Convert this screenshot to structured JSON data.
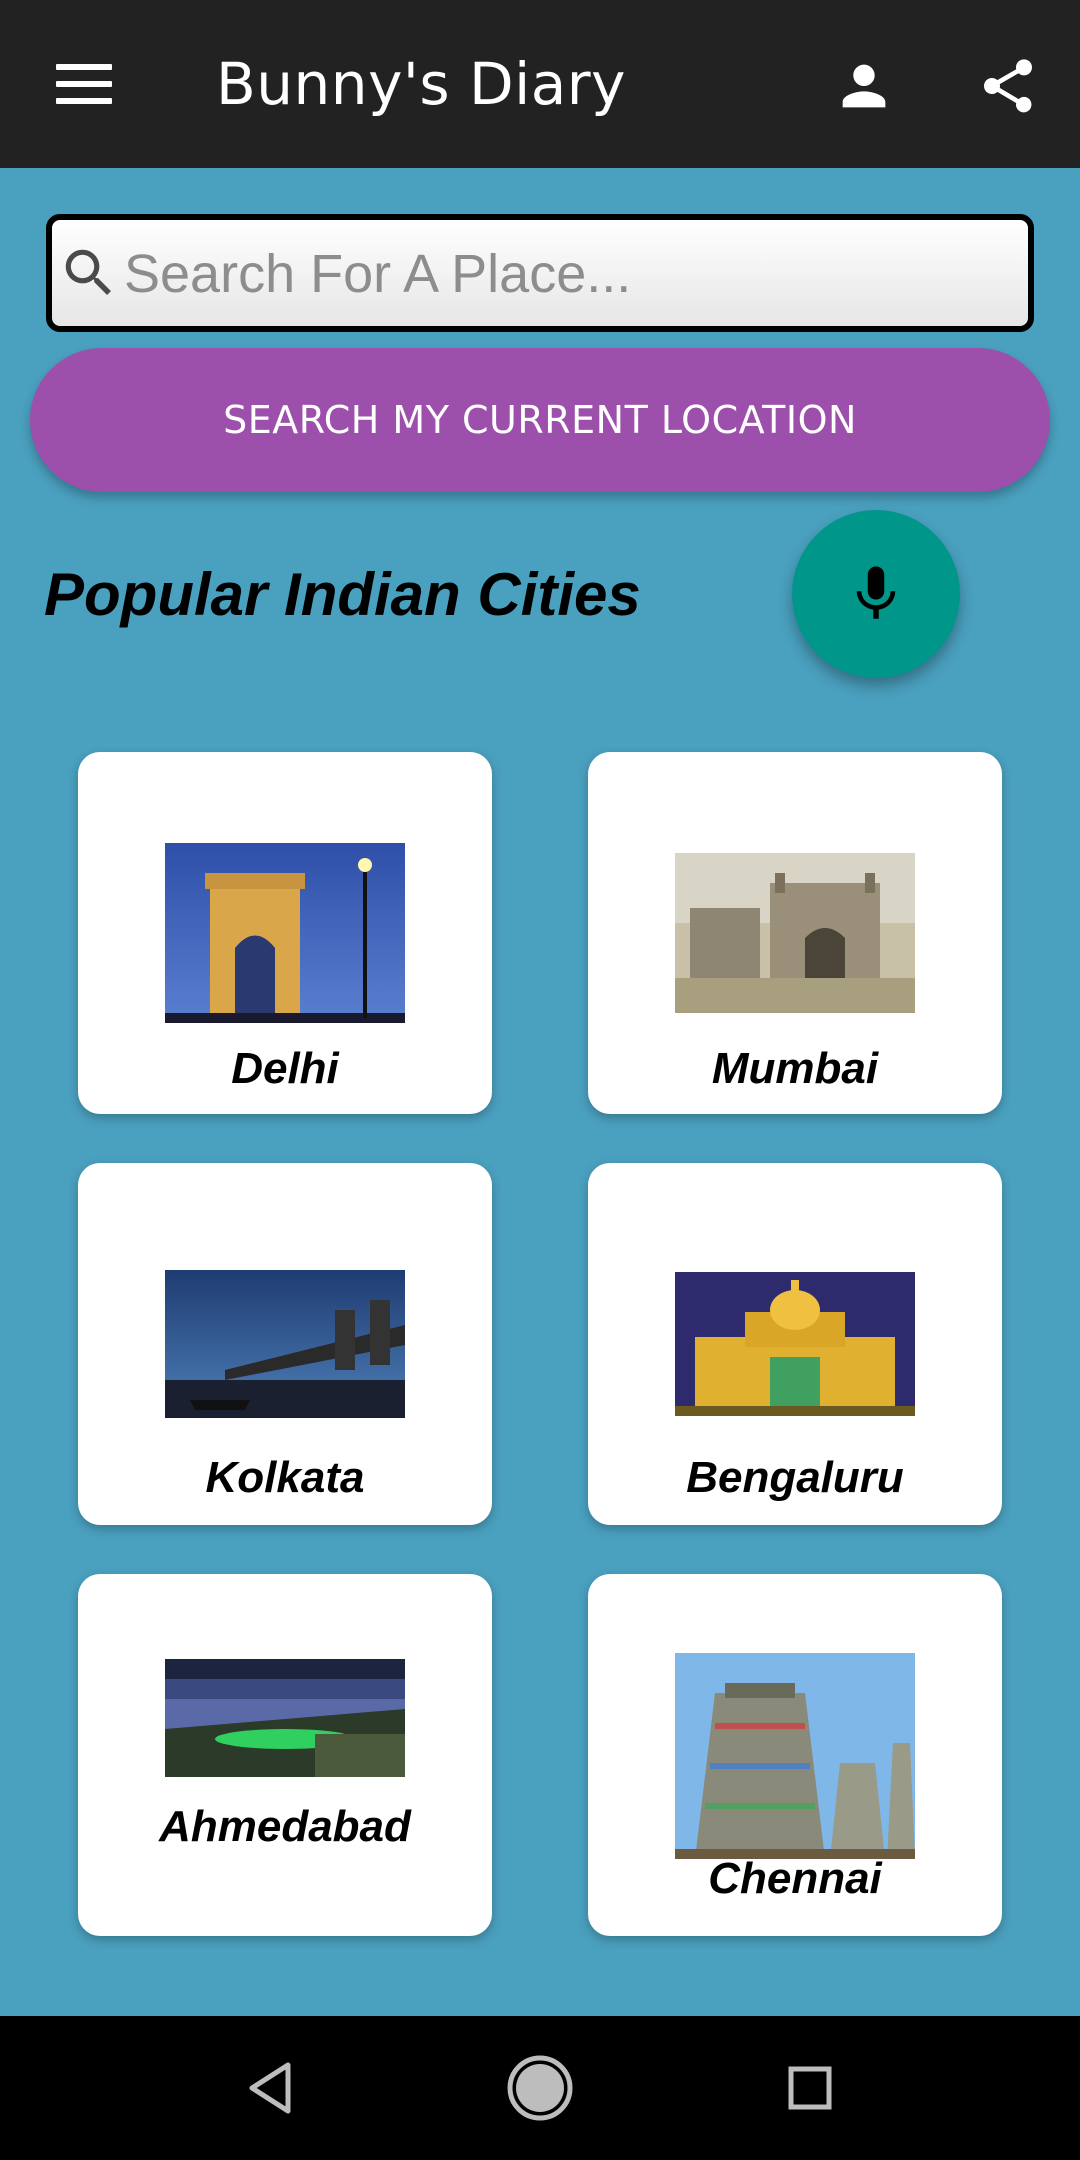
{
  "appbar": {
    "title": "Bunny's Diary",
    "menu_icon": "menu-icon",
    "account_icon": "account-icon",
    "share_icon": "share-icon"
  },
  "search": {
    "placeholder": "Search For A Place...",
    "value": "",
    "icon": "search-icon"
  },
  "location_button": {
    "label": "SEARCH MY CURRENT LOCATION"
  },
  "section": {
    "title": "Popular Indian Cities"
  },
  "mic_button": {
    "icon": "mic-icon"
  },
  "cities": [
    {
      "name": "Delhi"
    },
    {
      "name": "Mumbai"
    },
    {
      "name": "Kolkata"
    },
    {
      "name": "Bengaluru"
    },
    {
      "name": "Ahmedabad"
    },
    {
      "name": "Chennai"
    }
  ],
  "navbar": {
    "back_icon": "back-icon",
    "home_icon": "home-icon",
    "recents_icon": "recents-icon"
  },
  "colors": {
    "appbar": "#222222",
    "background": "#4aa0bf",
    "location_button": "#9c50ab",
    "mic_button": "#00968a",
    "card": "#ffffff"
  }
}
